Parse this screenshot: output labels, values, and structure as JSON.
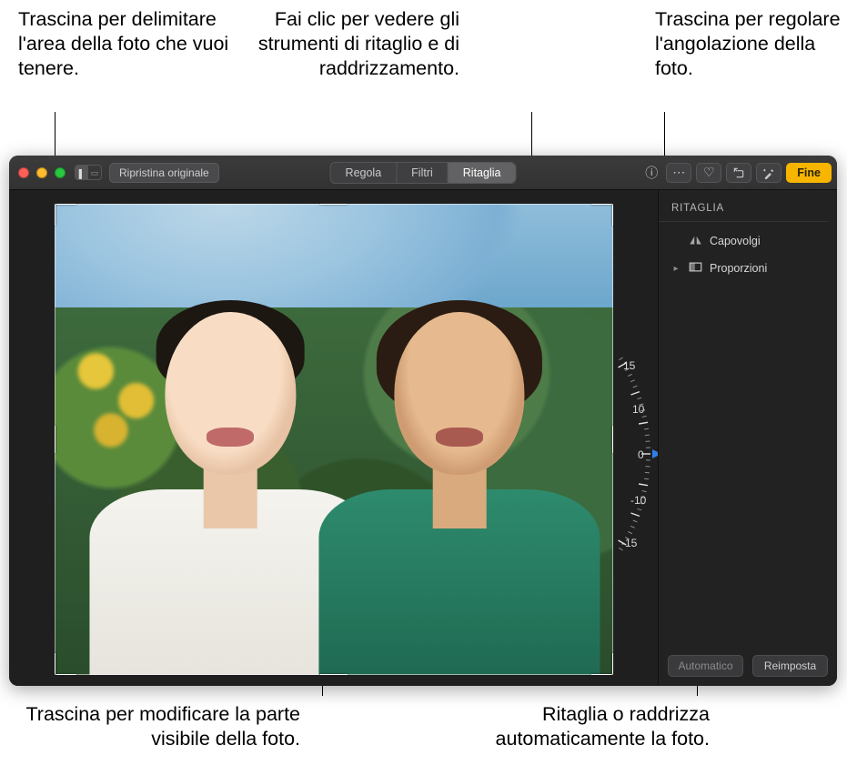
{
  "callouts": {
    "crop_area": "Trascina per delimitare l'area della foto che vuoi tenere.",
    "crop_tools": "Fai clic per vedere gli strumenti di ritaglio e di raddrizzamento.",
    "angle_dial": "Trascina per regolare l'angolazione della foto.",
    "visible_part": "Trascina per modificare la parte visibile della foto.",
    "auto": "Ritaglia o raddrizza automaticamente la foto."
  },
  "toolbar": {
    "revert": "Ripristina originale",
    "tabs": {
      "adjust": "Regola",
      "filters": "Filtri",
      "crop": "Ritaglia"
    },
    "done": "Fine"
  },
  "panel": {
    "title": "RITAGLIA",
    "flip": "Capovolgi",
    "aspect": "Proporzioni"
  },
  "angle": {
    "current": "0"
  },
  "buttons": {
    "auto": "Automatico",
    "reset": "Reimposta"
  }
}
